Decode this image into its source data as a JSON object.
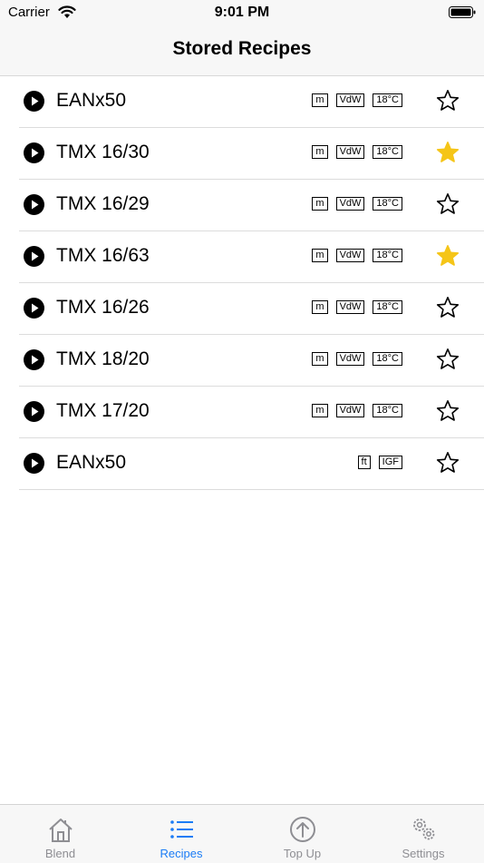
{
  "status": {
    "carrier": "Carrier",
    "time": "9:01 PM"
  },
  "nav": {
    "title": "Stored Recipes"
  },
  "colors": {
    "accent": "#1a7cf5",
    "favorite": "#f5c518",
    "inactive": "#8e8e93"
  },
  "recipes": [
    {
      "name": "EANx50",
      "tags": [
        "m",
        "VdW",
        "18°C"
      ],
      "favorite": false
    },
    {
      "name": "TMX 16/30",
      "tags": [
        "m",
        "VdW",
        "18°C"
      ],
      "favorite": true
    },
    {
      "name": "TMX 16/29",
      "tags": [
        "m",
        "VdW",
        "18°C"
      ],
      "favorite": false
    },
    {
      "name": "TMX 16/63",
      "tags": [
        "m",
        "VdW",
        "18°C"
      ],
      "favorite": true
    },
    {
      "name": "TMX 16/26",
      "tags": [
        "m",
        "VdW",
        "18°C"
      ],
      "favorite": false
    },
    {
      "name": "TMX 18/20",
      "tags": [
        "m",
        "VdW",
        "18°C"
      ],
      "favorite": false
    },
    {
      "name": "TMX 17/20",
      "tags": [
        "m",
        "VdW",
        "18°C"
      ],
      "favorite": false
    },
    {
      "name": "EANx50",
      "tags": [
        "ft",
        "IGF"
      ],
      "favorite": false
    }
  ],
  "tabs": [
    {
      "label": "Blend",
      "icon": "house-icon",
      "active": false
    },
    {
      "label": "Recipes",
      "icon": "list-icon",
      "active": true
    },
    {
      "label": "Top Up",
      "icon": "arrow-up-circle-icon",
      "active": false
    },
    {
      "label": "Settings",
      "icon": "gears-icon",
      "active": false
    }
  ]
}
